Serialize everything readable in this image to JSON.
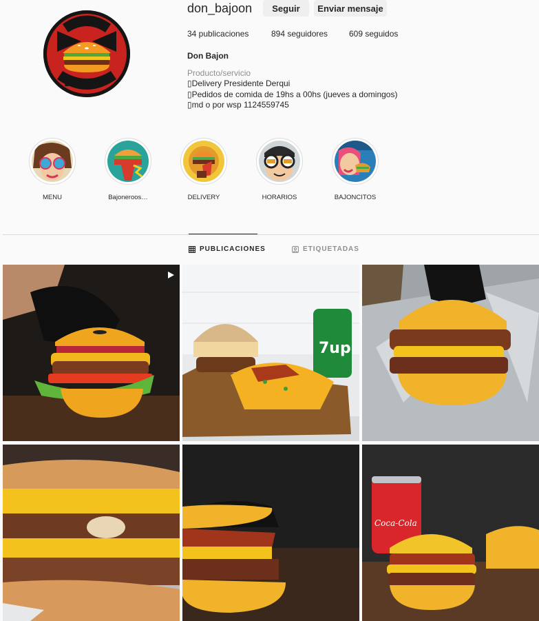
{
  "profile": {
    "username": "don_bajoon",
    "follow_label": "Seguir",
    "message_label": "Enviar mensaje",
    "posts_count": "34 publicaciones",
    "followers_count": "894 seguidores",
    "following_count": "609 seguidos",
    "full_name": "Don Bajon",
    "category": "Producto/servicio",
    "bio_lines": [
      "Delivery Presidente Derqui",
      "Pedidos de comida de 19hs a 00hs (jueves a domingos)",
      "md o por wsp 1124559745"
    ]
  },
  "highlights": [
    {
      "label": "MENU",
      "icon": "pop-art-woman-sunglasses"
    },
    {
      "label": "Bajoneroos…",
      "icon": "burger-character"
    },
    {
      "label": "DELIVERY",
      "icon": "delivery-burger"
    },
    {
      "label": "HORARIOS",
      "icon": "burger-goggles-character"
    },
    {
      "label": "BAJONCITOS",
      "icon": "woman-eating-burger"
    }
  ],
  "tabs": [
    {
      "label": "PUBLICACIONES",
      "icon": "grid-icon",
      "active": true
    },
    {
      "label": "ETIQUETADAS",
      "icon": "tagged-icon",
      "active": false
    }
  ],
  "posts": [
    {
      "subject": "cheeseburger held by gloved hand",
      "is_reel": true
    },
    {
      "subject": "burger with fries and 7up can"
    },
    {
      "subject": "double burger on foil with gloved hand"
    },
    {
      "subject": "cheeseburger close-up on foil"
    },
    {
      "subject": "bacon cheeseburger on wood"
    },
    {
      "subject": "burger with coca-cola can"
    }
  ],
  "brand_text": {
    "can_7up": "7up",
    "can_coke": "Coca-Cola"
  },
  "colors": {
    "background": "#fafafa",
    "button_bg": "#efefef",
    "text": "#262626",
    "muted": "#8e8e8e",
    "divider": "#dbdbdb"
  }
}
